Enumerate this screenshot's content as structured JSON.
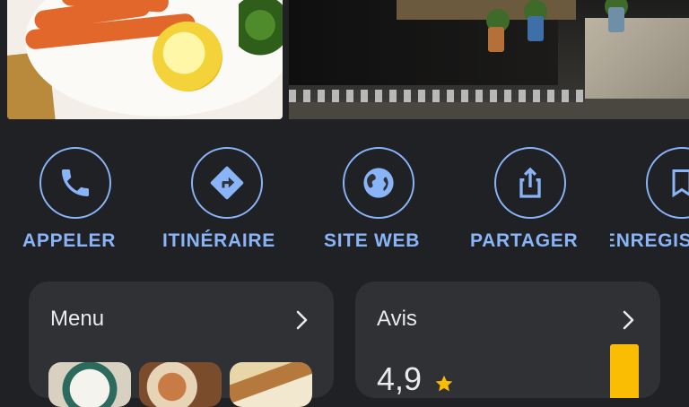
{
  "actions": [
    {
      "label": "APPELER",
      "icon": "phone-icon"
    },
    {
      "label": "ITINÉRAIRE",
      "icon": "directions-icon"
    },
    {
      "label": "SITE WEB",
      "icon": "globe-icon"
    },
    {
      "label": "PARTAGER",
      "icon": "share-icon"
    },
    {
      "label": "ENREGIS",
      "icon": "bookmark-icon"
    }
  ],
  "menu_card": {
    "title": "Menu",
    "icon": "chevron-right-icon"
  },
  "reviews_card": {
    "title": "Avis",
    "rating": "4,9",
    "icon": "chevron-right-icon",
    "star_icon": "star-icon"
  },
  "colors": {
    "accent": "#8ab4f8",
    "background": "#202124",
    "card": "#303134",
    "star": "#fbbc04"
  }
}
